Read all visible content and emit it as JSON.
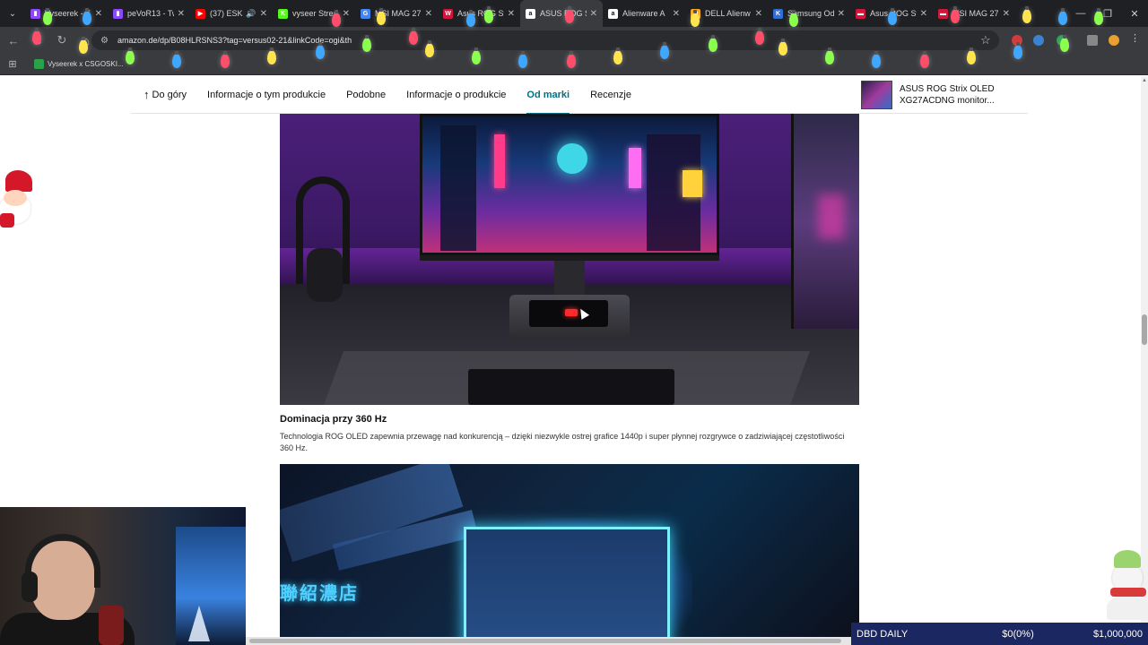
{
  "browser": {
    "tabs": [
      {
        "title": "Vyseerek - T",
        "fav_color": "#9146ff",
        "fav_glyph": "▮",
        "active": false
      },
      {
        "title": "peVoR13 - Tw",
        "fav_color": "#9146ff",
        "fav_glyph": "▮",
        "active": false
      },
      {
        "title": "(37) ESK",
        "fav_color": "#ff0000",
        "fav_glyph": "▶",
        "active": false,
        "audio": true
      },
      {
        "title": "vyseer Strea",
        "fav_color": "#53fc18",
        "fav_glyph": "K",
        "active": false
      },
      {
        "title": "MSI MAG 27",
        "fav_color": "#4285f4",
        "fav_glyph": "G",
        "active": false
      },
      {
        "title": "Asus ROG St",
        "fav_color": "#d4143a",
        "fav_glyph": "W",
        "active": false
      },
      {
        "title": "ASUS ROG S",
        "fav_color": "#ffffff",
        "fav_glyph": "a",
        "active": true
      },
      {
        "title": "Alienware A",
        "fav_color": "#ffffff",
        "fav_glyph": "a",
        "active": false
      },
      {
        "title": "DELL Alienw",
        "fav_color": "#f5a623",
        "fav_glyph": "O",
        "active": false
      },
      {
        "title": "Samsung Od",
        "fav_color": "#2f6fd6",
        "fav_glyph": "K",
        "active": false
      },
      {
        "title": "Asus ROG St",
        "fav_color": "#d4143a",
        "fav_glyph": "▬",
        "active": false
      },
      {
        "title": "MSI MAG 27",
        "fav_color": "#d4143a",
        "fav_glyph": "▬",
        "active": false
      }
    ],
    "url": "amazon.de/dp/B08HLRSNS3?tag=versus02-21&linkCode=ogi&th",
    "bookmarks": [
      {
        "label": "Vyseerek x CSGOSKI..."
      }
    ]
  },
  "subnav": {
    "items": [
      {
        "label": "Do góry",
        "active": false
      },
      {
        "label": "Informacje o tym produkcie",
        "active": false
      },
      {
        "label": "Podobne",
        "active": false
      },
      {
        "label": "Informacje o produkcie",
        "active": false
      },
      {
        "label": "Od marki",
        "active": true
      },
      {
        "label": "Recenzje",
        "active": false
      }
    ]
  },
  "mini_product": {
    "title_line1": "ASUS ROG Strix OLED",
    "title_line2": "XG27ACDNG monitor..."
  },
  "section": {
    "title": "Dominacja przy 360 Hz",
    "description": "Technologia ROG OLED zapewnia przewagę nad konkurencją – dzięki niezwykle ostrej grafice 1440p i super płynnej rozgrywce o zadziwiającej częstotliwości 360 Hz."
  },
  "hero2": {
    "sign_text": "聯紹濃店"
  },
  "ticker": {
    "name": "DBD DAILY",
    "value": "$0(0%)",
    "goal": "$1,000,000"
  },
  "colors": {
    "active_accent": "#007185",
    "ticker_bg": "#1b2760"
  }
}
